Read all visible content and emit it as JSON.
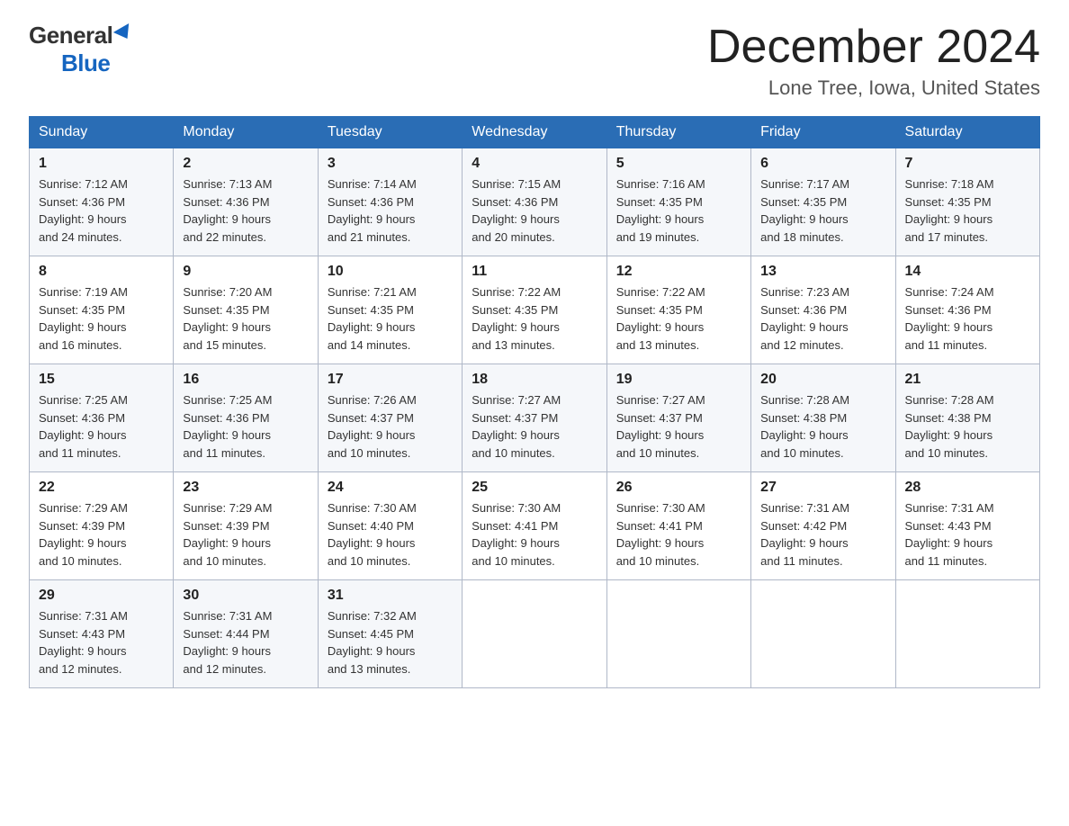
{
  "logo": {
    "general": "General",
    "blue": "Blue"
  },
  "header": {
    "month_year": "December 2024",
    "location": "Lone Tree, Iowa, United States"
  },
  "weekdays": [
    "Sunday",
    "Monday",
    "Tuesday",
    "Wednesday",
    "Thursday",
    "Friday",
    "Saturday"
  ],
  "weeks": [
    [
      {
        "day": "1",
        "sunrise": "7:12 AM",
        "sunset": "4:36 PM",
        "daylight": "9 hours and 24 minutes."
      },
      {
        "day": "2",
        "sunrise": "7:13 AM",
        "sunset": "4:36 PM",
        "daylight": "9 hours and 22 minutes."
      },
      {
        "day": "3",
        "sunrise": "7:14 AM",
        "sunset": "4:36 PM",
        "daylight": "9 hours and 21 minutes."
      },
      {
        "day": "4",
        "sunrise": "7:15 AM",
        "sunset": "4:36 PM",
        "daylight": "9 hours and 20 minutes."
      },
      {
        "day": "5",
        "sunrise": "7:16 AM",
        "sunset": "4:35 PM",
        "daylight": "9 hours and 19 minutes."
      },
      {
        "day": "6",
        "sunrise": "7:17 AM",
        "sunset": "4:35 PM",
        "daylight": "9 hours and 18 minutes."
      },
      {
        "day": "7",
        "sunrise": "7:18 AM",
        "sunset": "4:35 PM",
        "daylight": "9 hours and 17 minutes."
      }
    ],
    [
      {
        "day": "8",
        "sunrise": "7:19 AM",
        "sunset": "4:35 PM",
        "daylight": "9 hours and 16 minutes."
      },
      {
        "day": "9",
        "sunrise": "7:20 AM",
        "sunset": "4:35 PM",
        "daylight": "9 hours and 15 minutes."
      },
      {
        "day": "10",
        "sunrise": "7:21 AM",
        "sunset": "4:35 PM",
        "daylight": "9 hours and 14 minutes."
      },
      {
        "day": "11",
        "sunrise": "7:22 AM",
        "sunset": "4:35 PM",
        "daylight": "9 hours and 13 minutes."
      },
      {
        "day": "12",
        "sunrise": "7:22 AM",
        "sunset": "4:35 PM",
        "daylight": "9 hours and 13 minutes."
      },
      {
        "day": "13",
        "sunrise": "7:23 AM",
        "sunset": "4:36 PM",
        "daylight": "9 hours and 12 minutes."
      },
      {
        "day": "14",
        "sunrise": "7:24 AM",
        "sunset": "4:36 PM",
        "daylight": "9 hours and 11 minutes."
      }
    ],
    [
      {
        "day": "15",
        "sunrise": "7:25 AM",
        "sunset": "4:36 PM",
        "daylight": "9 hours and 11 minutes."
      },
      {
        "day": "16",
        "sunrise": "7:25 AM",
        "sunset": "4:36 PM",
        "daylight": "9 hours and 11 minutes."
      },
      {
        "day": "17",
        "sunrise": "7:26 AM",
        "sunset": "4:37 PM",
        "daylight": "9 hours and 10 minutes."
      },
      {
        "day": "18",
        "sunrise": "7:27 AM",
        "sunset": "4:37 PM",
        "daylight": "9 hours and 10 minutes."
      },
      {
        "day": "19",
        "sunrise": "7:27 AM",
        "sunset": "4:37 PM",
        "daylight": "9 hours and 10 minutes."
      },
      {
        "day": "20",
        "sunrise": "7:28 AM",
        "sunset": "4:38 PM",
        "daylight": "9 hours and 10 minutes."
      },
      {
        "day": "21",
        "sunrise": "7:28 AM",
        "sunset": "4:38 PM",
        "daylight": "9 hours and 10 minutes."
      }
    ],
    [
      {
        "day": "22",
        "sunrise": "7:29 AM",
        "sunset": "4:39 PM",
        "daylight": "9 hours and 10 minutes."
      },
      {
        "day": "23",
        "sunrise": "7:29 AM",
        "sunset": "4:39 PM",
        "daylight": "9 hours and 10 minutes."
      },
      {
        "day": "24",
        "sunrise": "7:30 AM",
        "sunset": "4:40 PM",
        "daylight": "9 hours and 10 minutes."
      },
      {
        "day": "25",
        "sunrise": "7:30 AM",
        "sunset": "4:41 PM",
        "daylight": "9 hours and 10 minutes."
      },
      {
        "day": "26",
        "sunrise": "7:30 AM",
        "sunset": "4:41 PM",
        "daylight": "9 hours and 10 minutes."
      },
      {
        "day": "27",
        "sunrise": "7:31 AM",
        "sunset": "4:42 PM",
        "daylight": "9 hours and 11 minutes."
      },
      {
        "day": "28",
        "sunrise": "7:31 AM",
        "sunset": "4:43 PM",
        "daylight": "9 hours and 11 minutes."
      }
    ],
    [
      {
        "day": "29",
        "sunrise": "7:31 AM",
        "sunset": "4:43 PM",
        "daylight": "9 hours and 12 minutes."
      },
      {
        "day": "30",
        "sunrise": "7:31 AM",
        "sunset": "4:44 PM",
        "daylight": "9 hours and 12 minutes."
      },
      {
        "day": "31",
        "sunrise": "7:32 AM",
        "sunset": "4:45 PM",
        "daylight": "9 hours and 13 minutes."
      },
      null,
      null,
      null,
      null
    ]
  ],
  "labels": {
    "sunrise": "Sunrise:",
    "sunset": "Sunset:",
    "daylight": "Daylight:"
  }
}
